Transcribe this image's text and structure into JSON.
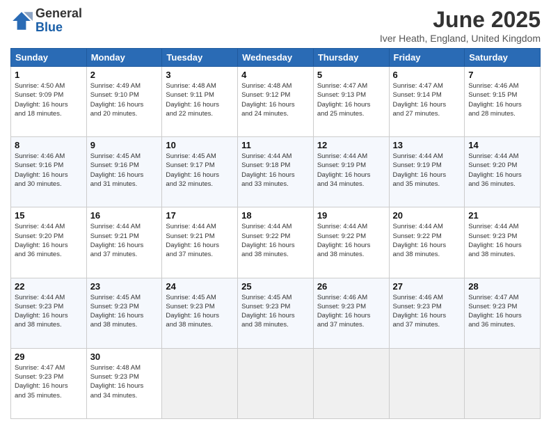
{
  "header": {
    "logo_general": "General",
    "logo_blue": "Blue",
    "month_title": "June 2025",
    "location": "Iver Heath, England, United Kingdom"
  },
  "days_of_week": [
    "Sunday",
    "Monday",
    "Tuesday",
    "Wednesday",
    "Thursday",
    "Friday",
    "Saturday"
  ],
  "weeks": [
    [
      {
        "day": "1",
        "info": "Sunrise: 4:50 AM\nSunset: 9:09 PM\nDaylight: 16 hours\nand 18 minutes."
      },
      {
        "day": "2",
        "info": "Sunrise: 4:49 AM\nSunset: 9:10 PM\nDaylight: 16 hours\nand 20 minutes."
      },
      {
        "day": "3",
        "info": "Sunrise: 4:48 AM\nSunset: 9:11 PM\nDaylight: 16 hours\nand 22 minutes."
      },
      {
        "day": "4",
        "info": "Sunrise: 4:48 AM\nSunset: 9:12 PM\nDaylight: 16 hours\nand 24 minutes."
      },
      {
        "day": "5",
        "info": "Sunrise: 4:47 AM\nSunset: 9:13 PM\nDaylight: 16 hours\nand 25 minutes."
      },
      {
        "day": "6",
        "info": "Sunrise: 4:47 AM\nSunset: 9:14 PM\nDaylight: 16 hours\nand 27 minutes."
      },
      {
        "day": "7",
        "info": "Sunrise: 4:46 AM\nSunset: 9:15 PM\nDaylight: 16 hours\nand 28 minutes."
      }
    ],
    [
      {
        "day": "8",
        "info": "Sunrise: 4:46 AM\nSunset: 9:16 PM\nDaylight: 16 hours\nand 30 minutes."
      },
      {
        "day": "9",
        "info": "Sunrise: 4:45 AM\nSunset: 9:16 PM\nDaylight: 16 hours\nand 31 minutes."
      },
      {
        "day": "10",
        "info": "Sunrise: 4:45 AM\nSunset: 9:17 PM\nDaylight: 16 hours\nand 32 minutes."
      },
      {
        "day": "11",
        "info": "Sunrise: 4:44 AM\nSunset: 9:18 PM\nDaylight: 16 hours\nand 33 minutes."
      },
      {
        "day": "12",
        "info": "Sunrise: 4:44 AM\nSunset: 9:19 PM\nDaylight: 16 hours\nand 34 minutes."
      },
      {
        "day": "13",
        "info": "Sunrise: 4:44 AM\nSunset: 9:19 PM\nDaylight: 16 hours\nand 35 minutes."
      },
      {
        "day": "14",
        "info": "Sunrise: 4:44 AM\nSunset: 9:20 PM\nDaylight: 16 hours\nand 36 minutes."
      }
    ],
    [
      {
        "day": "15",
        "info": "Sunrise: 4:44 AM\nSunset: 9:20 PM\nDaylight: 16 hours\nand 36 minutes."
      },
      {
        "day": "16",
        "info": "Sunrise: 4:44 AM\nSunset: 9:21 PM\nDaylight: 16 hours\nand 37 minutes."
      },
      {
        "day": "17",
        "info": "Sunrise: 4:44 AM\nSunset: 9:21 PM\nDaylight: 16 hours\nand 37 minutes."
      },
      {
        "day": "18",
        "info": "Sunrise: 4:44 AM\nSunset: 9:22 PM\nDaylight: 16 hours\nand 38 minutes."
      },
      {
        "day": "19",
        "info": "Sunrise: 4:44 AM\nSunset: 9:22 PM\nDaylight: 16 hours\nand 38 minutes."
      },
      {
        "day": "20",
        "info": "Sunrise: 4:44 AM\nSunset: 9:22 PM\nDaylight: 16 hours\nand 38 minutes."
      },
      {
        "day": "21",
        "info": "Sunrise: 4:44 AM\nSunset: 9:23 PM\nDaylight: 16 hours\nand 38 minutes."
      }
    ],
    [
      {
        "day": "22",
        "info": "Sunrise: 4:44 AM\nSunset: 9:23 PM\nDaylight: 16 hours\nand 38 minutes."
      },
      {
        "day": "23",
        "info": "Sunrise: 4:45 AM\nSunset: 9:23 PM\nDaylight: 16 hours\nand 38 minutes."
      },
      {
        "day": "24",
        "info": "Sunrise: 4:45 AM\nSunset: 9:23 PM\nDaylight: 16 hours\nand 38 minutes."
      },
      {
        "day": "25",
        "info": "Sunrise: 4:45 AM\nSunset: 9:23 PM\nDaylight: 16 hours\nand 38 minutes."
      },
      {
        "day": "26",
        "info": "Sunrise: 4:46 AM\nSunset: 9:23 PM\nDaylight: 16 hours\nand 37 minutes."
      },
      {
        "day": "27",
        "info": "Sunrise: 4:46 AM\nSunset: 9:23 PM\nDaylight: 16 hours\nand 37 minutes."
      },
      {
        "day": "28",
        "info": "Sunrise: 4:47 AM\nSunset: 9:23 PM\nDaylight: 16 hours\nand 36 minutes."
      }
    ],
    [
      {
        "day": "29",
        "info": "Sunrise: 4:47 AM\nSunset: 9:23 PM\nDaylight: 16 hours\nand 35 minutes."
      },
      {
        "day": "30",
        "info": "Sunrise: 4:48 AM\nSunset: 9:23 PM\nDaylight: 16 hours\nand 34 minutes."
      },
      {
        "day": "",
        "info": ""
      },
      {
        "day": "",
        "info": ""
      },
      {
        "day": "",
        "info": ""
      },
      {
        "day": "",
        "info": ""
      },
      {
        "day": "",
        "info": ""
      }
    ]
  ]
}
